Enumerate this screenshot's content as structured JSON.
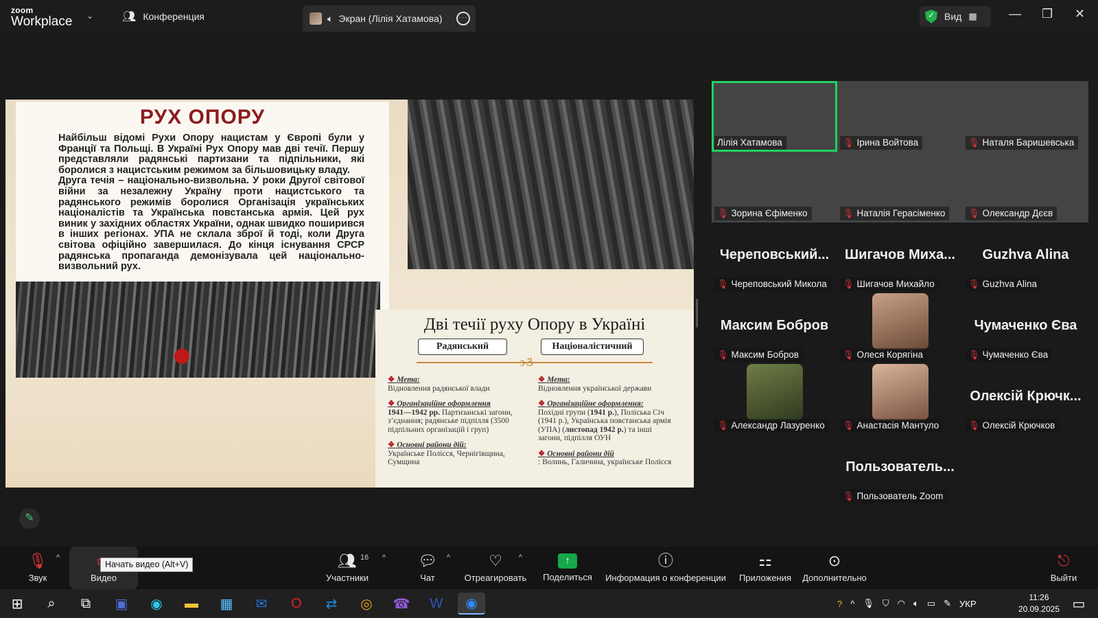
{
  "app": {
    "logo_small": "zoom",
    "logo_big": "Workplace",
    "conference_tab": "Конференция",
    "screen_tab": "Экран (Лілія Хатамова)",
    "view_label": "Вид"
  },
  "slide": {
    "title": "РУХ ОПОРУ",
    "body": "Найбільш відомі Рухи Опору нацистам у Європі були у Франції та Польщі. В Україні Рух Опору мав дві течії. Першу представляли радянські партизани та підпільники, які боролися з нацистським режимом за більшовицьку владу.\nДруга течія – національно-визвольна. У роки Другої світової війни за незалежну Україну проти нацистського та радянського режимів боролися Організація українських націоналістів та Українська повстанська армія. Цей рух виник у західних областях України, однак швидко поширився в інших регіонах. УПА не склала зброї й тоді, коли Друга світова офіційно завершилася. До кінця існування СРСР радянська пропаганда демонізувала цей національно-визвольний рух.",
    "table_title": "Дві течії руху Опору в Україні",
    "col_left": {
      "header": "Радянський",
      "goal_h": "Мета:",
      "goal": "Відновлення радянської влади",
      "org_h": "Організаційне оформлення",
      "org_years": "1941—1942 рр.",
      "org": "Партизанські загони, з’єднання; радянське підпілля (3500 підпільних організацій і груп)",
      "areas_h": "Основні райони дій:",
      "areas": "Українське Полісся, Чернігівщина, Сумщина"
    },
    "col_right": {
      "header": "Націоналістичний",
      "goal_h": "Мета:",
      "goal": "Відновлення української держави",
      "org_h": "Організаційне оформлення:",
      "org_a": "Похідні групи (",
      "org_a_bold": "1941 р.",
      "org_b": "), Поліська Січ (1941 р.), Українська повстанська армія (УПА) (",
      "org_b_bold": "листопад 1942 р.",
      "org_c": ") та інші загони, підпілля ОУН",
      "areas_h": "Основні райони дій",
      "areas": ": Волинь, Галичина, українське Полісся"
    }
  },
  "participants": [
    {
      "tile": "Лілія Хатамова",
      "video": true,
      "active": true,
      "muted": false
    },
    {
      "tile": "Ірина Войтова",
      "video": true,
      "muted": true
    },
    {
      "tile": "Наталя Баришевська",
      "video": true,
      "muted": true
    },
    {
      "tile": "Зорина Єфіменко",
      "video": true,
      "muted": true
    },
    {
      "tile": "Наталія Герасіменко",
      "video": true,
      "muted": true
    },
    {
      "tile": "Олександр Дєєв",
      "video": true,
      "muted": true
    },
    {
      "big": "Череповський...",
      "tile": "Череповський Микола",
      "muted": true
    },
    {
      "big": "Шигачов Миха...",
      "tile": "Шигачов Михайло",
      "muted": true
    },
    {
      "big": "Guzhva Alina",
      "tile": "Guzhva Alina",
      "muted": true
    },
    {
      "big": "Максим Бобров",
      "tile": "Максим Бобров",
      "muted": true
    },
    {
      "tile": "Олеся Корягіна",
      "avatar": true,
      "muted": true
    },
    {
      "big": "Чумаченко Єва",
      "tile": "Чумаченко Єва",
      "muted": true
    },
    {
      "tile": "Александр Лазуренко",
      "avatar": true,
      "muted": true
    },
    {
      "tile": "Анастасія Мантуло",
      "avatar": true,
      "muted": true
    },
    {
      "big": "Олексій Крючк...",
      "tile": "Олексій Крючков",
      "muted": true
    },
    {
      "big": "Пользователь...",
      "tile": "Пользователь Zoom",
      "muted": true
    }
  ],
  "toolbar": {
    "audio": "Звук",
    "video": "Видео",
    "video_tooltip": "Начать видео (Alt+V)",
    "participants": "Участники",
    "participants_count": "16",
    "chat": "Чат",
    "react": "Отреагировать",
    "share": "Поделиться",
    "info": "Информация о конференции",
    "apps": "Приложения",
    "more": "Дополнительно",
    "leave": "Выйти"
  },
  "taskbar": {
    "lang": "УКР",
    "time": "11:26",
    "date": "20.09.2025"
  },
  "colors": {
    "active_speaker": "#23d160",
    "muted": "#e0343a",
    "share": "#14a84b"
  }
}
